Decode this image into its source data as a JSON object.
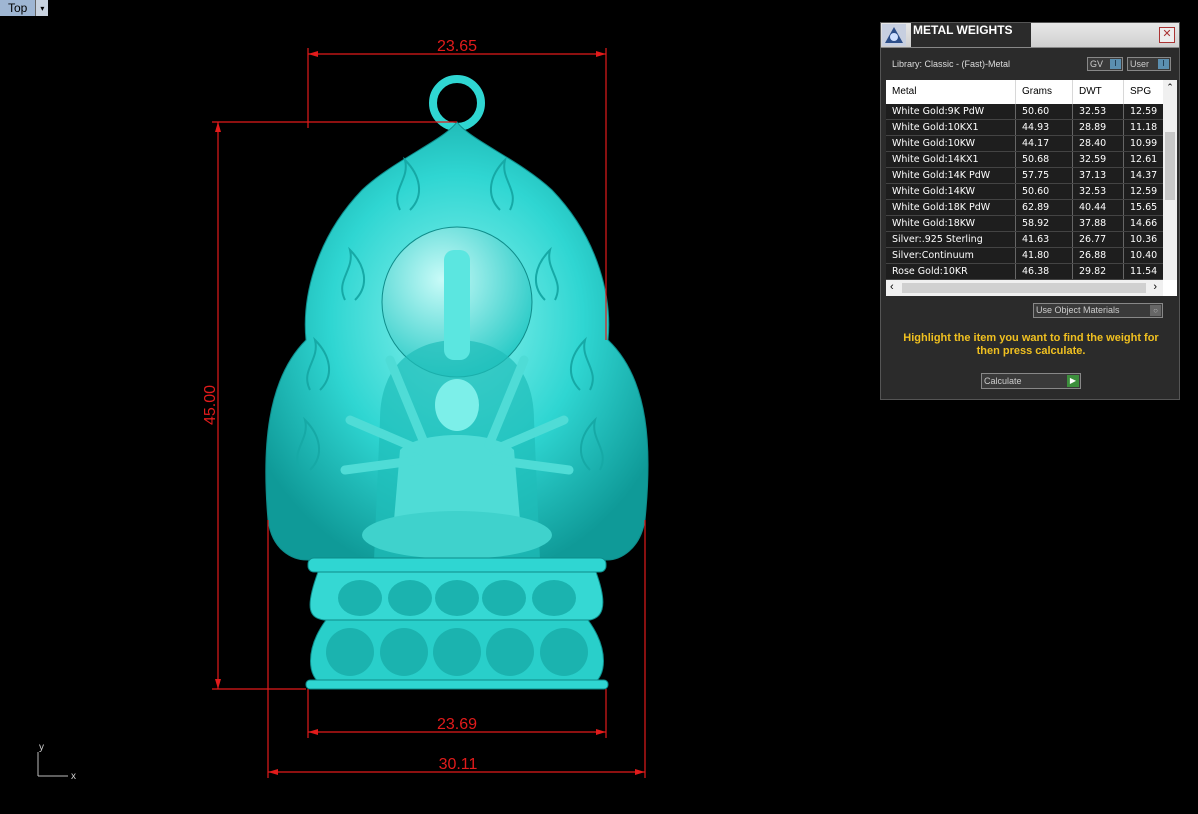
{
  "viewport": {
    "name": "Top",
    "axes": {
      "y_label": "y",
      "x_label": "x"
    },
    "dimensions": {
      "top_width": "23.65",
      "height": "45.00",
      "base_width": "23.69",
      "total_width": "30.11"
    },
    "colors": {
      "model": "#2fd6d2",
      "dimension": "#e11b1b",
      "background": "#000000"
    }
  },
  "panel": {
    "title": "METAL WEIGHTS",
    "library_label": "Library: Classic - (Fast)-Metal",
    "toggles": {
      "gv": "GV",
      "user": "User"
    },
    "table": {
      "headers": [
        "Metal",
        "Grams",
        "DWT",
        "SPG"
      ],
      "rows": [
        [
          "White Gold:9K PdW",
          "50.60",
          "32.53",
          "12.59"
        ],
        [
          "White Gold:10KX1",
          "44.93",
          "28.89",
          "11.18"
        ],
        [
          "White Gold:10KW",
          "44.17",
          "28.40",
          "10.99"
        ],
        [
          "White Gold:14KX1",
          "50.68",
          "32.59",
          "12.61"
        ],
        [
          "White Gold:14K PdW",
          "57.75",
          "37.13",
          "14.37"
        ],
        [
          "White Gold:14KW",
          "50.60",
          "32.53",
          "12.59"
        ],
        [
          "White Gold:18K PdW",
          "62.89",
          "40.44",
          "15.65"
        ],
        [
          "White Gold:18KW",
          "58.92",
          "37.88",
          "14.66"
        ],
        [
          "Silver:.925 Sterling",
          "41.63",
          "26.77",
          "10.36"
        ],
        [
          "Silver:Continuum",
          "41.80",
          "26.88",
          "10.40"
        ],
        [
          "Rose Gold:10KR",
          "46.38",
          "29.82",
          "11.54"
        ]
      ]
    },
    "use_object_materials": "Use Object Materials",
    "message": "Highlight the item you want to find the weight for then press calculate.",
    "calculate_label": "Calculate"
  }
}
